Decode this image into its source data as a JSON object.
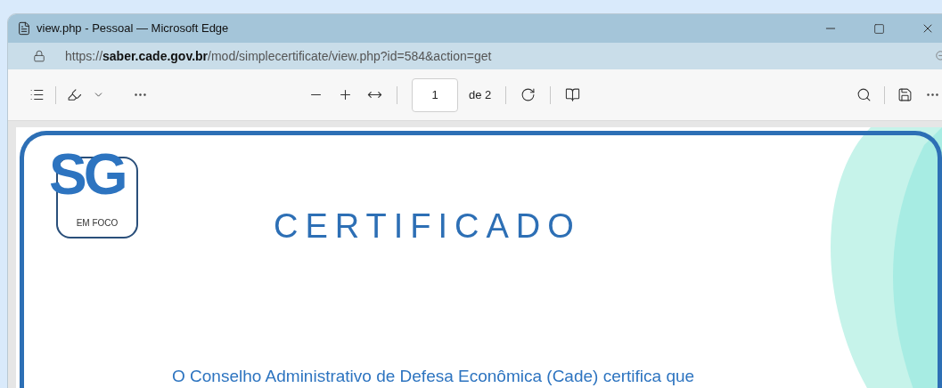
{
  "window": {
    "title": "view.php - Pessoal — Microsoft Edge"
  },
  "address_bar": {
    "url": "https://**saber.cade.gov.br**/mod/simplecertificate/view.php?id=584&action=get"
  },
  "pdf_toolbar": {
    "page_field": {
      "value": "1"
    },
    "page_count": "de 2"
  },
  "certificate": {
    "logo": {
      "initials": "SG",
      "tagline": "EM FOCO"
    },
    "title": "CERTIFICADO",
    "body": "O Conselho Administrativo de Defesa Econômica (Cade) certifica que"
  }
}
